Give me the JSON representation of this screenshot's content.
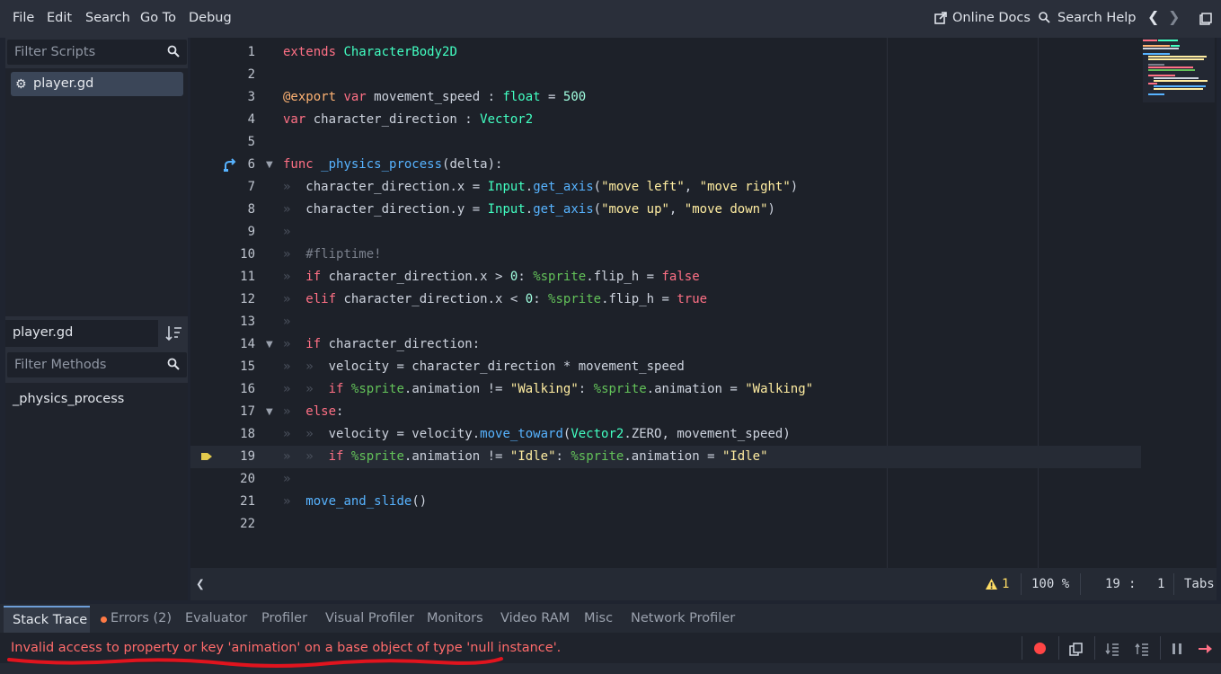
{
  "menu": {
    "items": [
      "File",
      "Edit",
      "Search",
      "Go To",
      "Debug"
    ],
    "online_docs": "Online Docs",
    "search_help": "Search Help"
  },
  "scripts_panel": {
    "filter_placeholder": "Filter Scripts",
    "items": [
      {
        "name": "player.gd",
        "icon": "gear-icon"
      }
    ],
    "current_file": "player.gd",
    "methods_placeholder": "Filter Methods",
    "methods": [
      "_physics_process"
    ]
  },
  "editor": {
    "line_numbers": [
      "1",
      "2",
      "3",
      "4",
      "5",
      "6",
      "7",
      "8",
      "9",
      "10",
      "11",
      "12",
      "13",
      "14",
      "15",
      "16",
      "17",
      "18",
      "19",
      "20",
      "21",
      "22"
    ],
    "current_line": 19,
    "lines": [
      [
        {
          "t": "extends ",
          "c": "kw"
        },
        {
          "t": "CharacterBody2D",
          "c": "cls"
        }
      ],
      [],
      [
        {
          "t": "@export ",
          "c": "ann"
        },
        {
          "t": "var ",
          "c": "kw"
        },
        {
          "t": "movement_speed : "
        },
        {
          "t": "float",
          "c": "ty"
        },
        {
          "t": " = "
        },
        {
          "t": "500",
          "c": "num"
        }
      ],
      [
        {
          "t": "var ",
          "c": "kw"
        },
        {
          "t": "character_direction : "
        },
        {
          "t": "Vector2",
          "c": "ty"
        }
      ],
      [],
      [
        {
          "t": "func ",
          "c": "kw"
        },
        {
          "t": "_physics_process",
          "c": "fn"
        },
        {
          "t": "(delta):"
        }
      ],
      [
        {
          "t": "»  ",
          "c": "tabmark"
        },
        {
          "t": "character_direction.x = "
        },
        {
          "t": "Input",
          "c": "cls"
        },
        {
          "t": "."
        },
        {
          "t": "get_axis",
          "c": "fn"
        },
        {
          "t": "("
        },
        {
          "t": "\"move left\"",
          "c": "str"
        },
        {
          "t": ", "
        },
        {
          "t": "\"move right\"",
          "c": "str"
        },
        {
          "t": ")"
        }
      ],
      [
        {
          "t": "»  ",
          "c": "tabmark"
        },
        {
          "t": "character_direction.y = "
        },
        {
          "t": "Input",
          "c": "cls"
        },
        {
          "t": "."
        },
        {
          "t": "get_axis",
          "c": "fn"
        },
        {
          "t": "("
        },
        {
          "t": "\"move up\"",
          "c": "str"
        },
        {
          "t": ", "
        },
        {
          "t": "\"move down\"",
          "c": "str"
        },
        {
          "t": ")"
        }
      ],
      [
        {
          "t": "»",
          "c": "tabmark"
        }
      ],
      [
        {
          "t": "»  ",
          "c": "tabmark"
        },
        {
          "t": "#fliptime!",
          "c": "cm"
        }
      ],
      [
        {
          "t": "»  ",
          "c": "tabmark"
        },
        {
          "t": "if ",
          "c": "kw"
        },
        {
          "t": "character_direction.x > "
        },
        {
          "t": "0",
          "c": "num"
        },
        {
          "t": ": "
        },
        {
          "t": "%sprite",
          "c": "node"
        },
        {
          "t": ".flip_h = "
        },
        {
          "t": "false",
          "c": "kw"
        }
      ],
      [
        {
          "t": "»  ",
          "c": "tabmark"
        },
        {
          "t": "elif ",
          "c": "kw"
        },
        {
          "t": "character_direction.x < "
        },
        {
          "t": "0",
          "c": "num"
        },
        {
          "t": ": "
        },
        {
          "t": "%sprite",
          "c": "node"
        },
        {
          "t": ".flip_h = "
        },
        {
          "t": "true",
          "c": "kw"
        }
      ],
      [
        {
          "t": "»",
          "c": "tabmark"
        }
      ],
      [
        {
          "t": "»  ",
          "c": "tabmark"
        },
        {
          "t": "if ",
          "c": "kw"
        },
        {
          "t": "character_direction:"
        }
      ],
      [
        {
          "t": "»  ",
          "c": "tabmark"
        },
        {
          "t": "»  ",
          "c": "tabmark"
        },
        {
          "t": "velocity = character_direction * movement_speed"
        }
      ],
      [
        {
          "t": "»  ",
          "c": "tabmark"
        },
        {
          "t": "»  ",
          "c": "tabmark"
        },
        {
          "t": "if ",
          "c": "kw"
        },
        {
          "t": "%sprite",
          "c": "node"
        },
        {
          "t": ".animation != "
        },
        {
          "t": "\"Walking\"",
          "c": "str"
        },
        {
          "t": ": "
        },
        {
          "t": "%sprite",
          "c": "node"
        },
        {
          "t": ".animation = "
        },
        {
          "t": "\"Walking\"",
          "c": "str"
        }
      ],
      [
        {
          "t": "»  ",
          "c": "tabmark"
        },
        {
          "t": "else",
          "c": "kw"
        },
        {
          "t": ":"
        }
      ],
      [
        {
          "t": "»  ",
          "c": "tabmark"
        },
        {
          "t": "»  ",
          "c": "tabmark"
        },
        {
          "t": "velocity = velocity."
        },
        {
          "t": "move_toward",
          "c": "fn"
        },
        {
          "t": "("
        },
        {
          "t": "Vector2",
          "c": "ty"
        },
        {
          "t": ".ZERO, movement_speed)"
        }
      ],
      [
        {
          "t": "»  ",
          "c": "tabmark"
        },
        {
          "t": "»  ",
          "c": "tabmark"
        },
        {
          "t": "if ",
          "c": "kw"
        },
        {
          "t": "%sprite",
          "c": "node"
        },
        {
          "t": ".animation != "
        },
        {
          "t": "\"Idle\"",
          "c": "str"
        },
        {
          "t": ": "
        },
        {
          "t": "%sprite",
          "c": "node"
        },
        {
          "t": ".animation = "
        },
        {
          "t": "\"Idle\"",
          "c": "str"
        }
      ],
      [
        {
          "t": "»",
          "c": "tabmark"
        }
      ],
      [
        {
          "t": "»  ",
          "c": "tabmark"
        },
        {
          "t": "move_and_slide",
          "c": "fn"
        },
        {
          "t": "()"
        }
      ],
      []
    ]
  },
  "status": {
    "warnings": "1",
    "zoom": "100 %",
    "line": "19",
    "colon": ":",
    "col": "1",
    "indent": "Tabs"
  },
  "bottom": {
    "tabs": [
      "Stack Trace",
      "Errors (2)",
      "Evaluator",
      "Profiler",
      "Visual Profiler",
      "Monitors",
      "Video RAM",
      "Misc",
      "Network Profiler"
    ],
    "error_message": "Invalid access to property or key 'animation' on a base object of type 'null instance'."
  },
  "colors": {
    "error": "#ff6b6b",
    "accent": "#6e9ed8",
    "breakpoint": "#ff4545",
    "annotation_stroke": "#e0141e"
  }
}
